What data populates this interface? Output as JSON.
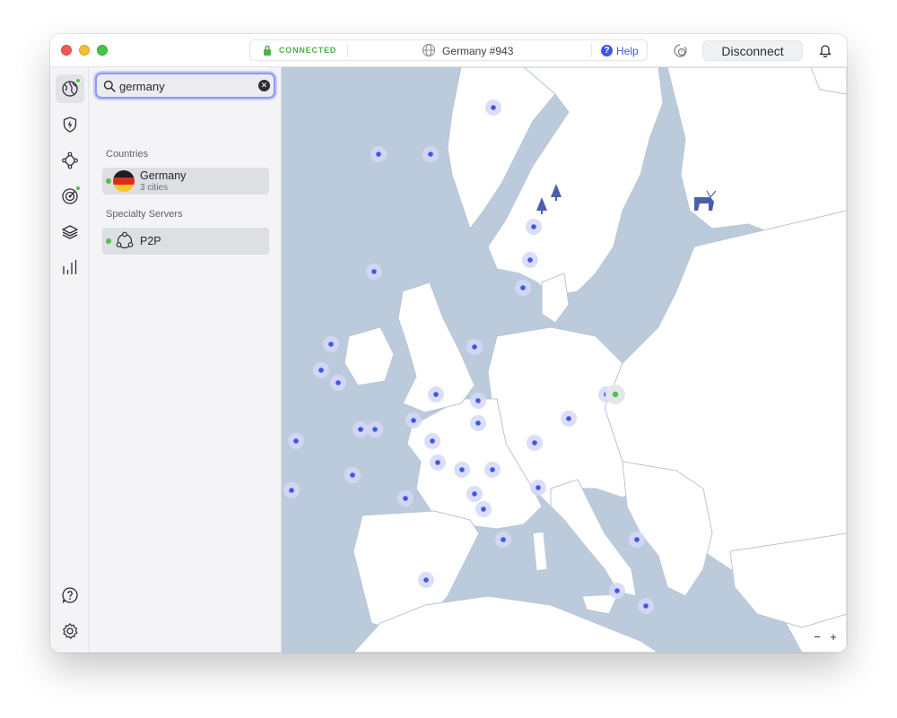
{
  "titlebar": {
    "status": "CONNECTED",
    "server": "Germany #943",
    "help_label": "Help",
    "disconnect_label": "Disconnect"
  },
  "rail": {
    "items": [
      {
        "name": "globe-icon",
        "active": true,
        "badge": true
      },
      {
        "name": "shield-bolt-icon",
        "active": false,
        "badge": false
      },
      {
        "name": "meshnet-icon",
        "active": false,
        "badge": false
      },
      {
        "name": "radar-icon",
        "active": false,
        "badge": true
      },
      {
        "name": "layers-icon",
        "active": false,
        "badge": false
      },
      {
        "name": "stats-icon",
        "active": false,
        "badge": false
      }
    ],
    "bottom": [
      {
        "name": "help-circle-icon"
      },
      {
        "name": "settings-gear-icon"
      }
    ]
  },
  "search": {
    "value": "germany",
    "countries_label": "Countries",
    "specialty_label": "Specialty Servers",
    "results": [
      {
        "title": "Germany",
        "subtitle": "3 cities",
        "flag": "germany-flag-icon"
      }
    ],
    "specialty": [
      {
        "title": "P2P",
        "icon": "p2p-icon"
      }
    ]
  },
  "map": {
    "zoom_out": "−",
    "zoom_in": "+",
    "colors": {
      "sea": "#bccbdb",
      "land": "#ffffff",
      "border": "#b9c6d6",
      "server_dot": "#3f57e8",
      "server_halo": "#d3d8f8",
      "connected": "#4bc14f"
    }
  }
}
